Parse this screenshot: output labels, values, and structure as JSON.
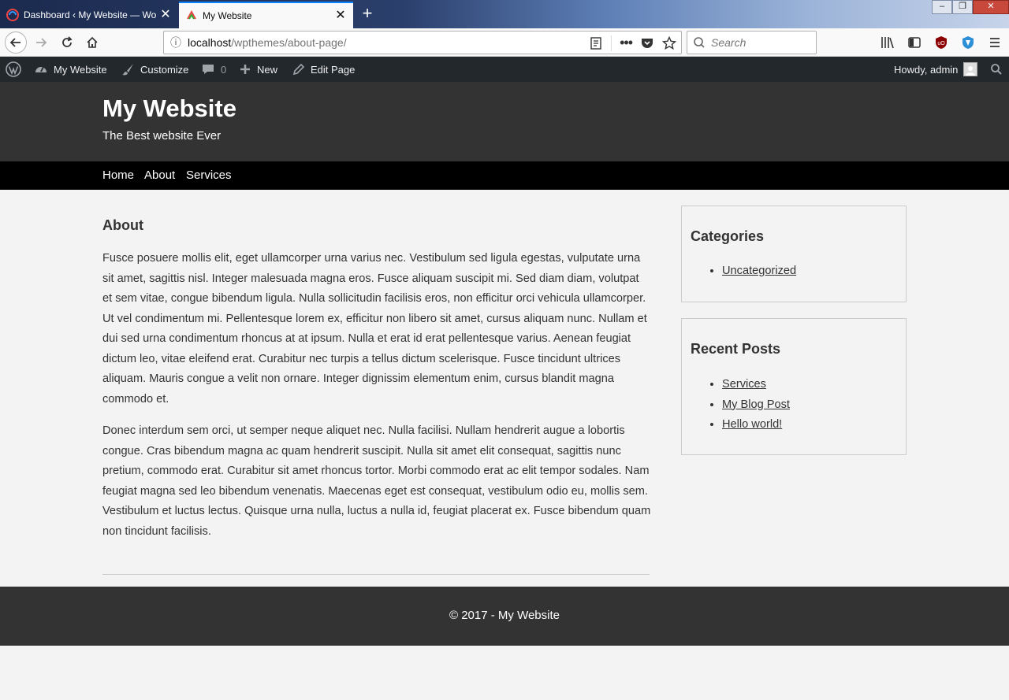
{
  "browser": {
    "tabs": [
      {
        "title": "Dashboard ‹ My Website — Wo",
        "active": false
      },
      {
        "title": "My Website",
        "active": true
      }
    ],
    "url": {
      "host": "localhost",
      "path": "/wpthemes/about-page/"
    },
    "search_placeholder": "Search",
    "accent": "#0a84ff"
  },
  "admin_bar": {
    "site_name": "My Website",
    "customize": "Customize",
    "comments_count": "0",
    "new": "New",
    "edit_page": "Edit Page",
    "howdy": "Howdy, admin"
  },
  "site": {
    "title": "My Website",
    "tagline": "The Best website Ever",
    "nav": [
      "Home",
      "About",
      "Services"
    ]
  },
  "page": {
    "title": "About",
    "paragraphs": [
      "Fusce posuere mollis elit, eget ullamcorper urna varius nec. Vestibulum sed ligula egestas, vulputate urna sit amet, sagittis nisl. Integer malesuada magna eros. Fusce aliquam suscipit mi. Sed diam diam, volutpat et sem vitae, congue bibendum ligula. Nulla sollicitudin facilisis eros, non efficitur orci vehicula ullamcorper. Ut vel condimentum mi. Pellentesque lorem ex, efficitur non libero sit amet, cursus aliquam nunc. Nullam et dui sed urna condimentum rhoncus at at ipsum. Nulla et erat id erat pellentesque varius. Aenean feugiat dictum leo, vitae eleifend erat. Curabitur nec turpis a tellus dictum scelerisque. Fusce tincidunt ultrices aliquam. Mauris congue a velit non ornare. Integer dignissim elementum enim, cursus blandit magna commodo et.",
      "Donec interdum sem orci, ut semper neque aliquet nec. Nulla facilisi. Nullam hendrerit augue a lobortis congue. Cras bibendum magna ac quam hendrerit suscipit. Nulla sit amet elit consequat, sagittis nunc pretium, commodo erat. Curabitur sit amet rhoncus tortor. Morbi commodo erat ac elit tempor sodales. Nam feugiat magna sed leo bibendum venenatis. Maecenas eget est consequat, vestibulum odio eu, mollis sem. Vestibulum et luctus lectus. Quisque urna nulla, luctus a nulla id, feugiat placerat ex. Fusce bibendum quam non tincidunt facilisis."
    ]
  },
  "sidebar": {
    "categories": {
      "title": "Categories",
      "items": [
        "Uncategorized"
      ]
    },
    "recent_posts": {
      "title": "Recent Posts",
      "items": [
        "Services",
        "My Blog Post",
        "Hello world!"
      ]
    }
  },
  "footer": {
    "text": "© 2017 - My Website"
  }
}
